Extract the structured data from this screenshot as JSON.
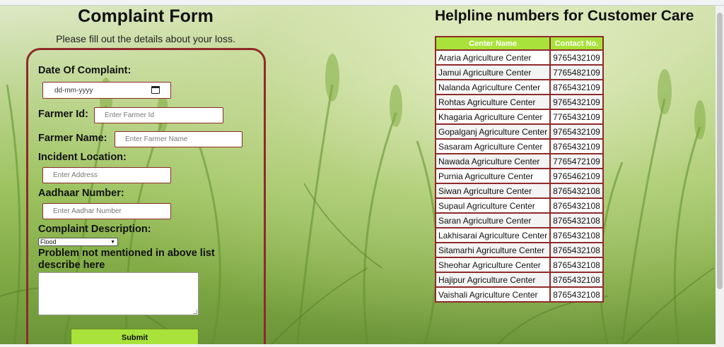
{
  "form": {
    "title": "Complaint Form",
    "subtitle": "Please fill out the details about your loss.",
    "date_label": "Date Of Complaint:",
    "date_placeholder": "dd-mm-yyyy",
    "farmer_id_label": "Farmer Id:",
    "farmer_id_placeholder": "Enter Farmer Id",
    "farmer_name_label": "Farmer Name:",
    "farmer_name_placeholder": "Enter Farmer Name",
    "location_label": "Incident Location:",
    "location_placeholder": "Enter Address",
    "aadhaar_label": "Aadhaar Number:",
    "aadhaar_placeholder": "Enter Aadhar Number",
    "description_label": "Complaint Description:",
    "description_selected": "Flood",
    "other_label": "Problem not mentioned in above list describe here",
    "submit_label": "Submit"
  },
  "helpline": {
    "title": "Helpline numbers for Customer Care",
    "columns": [
      "Center Name",
      "Contact No."
    ],
    "rows": [
      [
        "Araria Agriculture Center",
        "9765432109"
      ],
      [
        "Jamui Agriculture Center",
        "7765482109"
      ],
      [
        "Nalanda Agriculture Center",
        "8765432109"
      ],
      [
        "Rohtas Agriculture Center",
        "9765432109"
      ],
      [
        "Khagaria Agriculture Center",
        "7765432109"
      ],
      [
        "Gopalganj Agriculture Center",
        "9765432109"
      ],
      [
        "Sasaram Agriculture Center",
        "8765432109"
      ],
      [
        "Nawada Agriculture Center",
        "7765472109"
      ],
      [
        "Purnia Agriculture Center",
        "9765462109"
      ],
      [
        "Siwan Agriculture Center",
        "8765432108"
      ],
      [
        "Supaul Agriculture Center",
        "8765432108"
      ],
      [
        "Saran Agriculture Center",
        "8765432108"
      ],
      [
        "Lakhisarai Agriculture Center",
        "8765432108"
      ],
      [
        "Sitamarhi Agriculture Center",
        "8765432108"
      ],
      [
        "Sheohar Agriculture Center",
        "8765432108"
      ],
      [
        "Hajipur Agriculture Center",
        "8765432108"
      ],
      [
        "Vaishali Agriculture Center",
        "8765432108"
      ]
    ]
  },
  "colors": {
    "accent_green": "#a9e23a",
    "border_maroon": "#8e2a2a"
  },
  "icons": [
    "calendar-icon",
    "chevron-down-icon"
  ]
}
